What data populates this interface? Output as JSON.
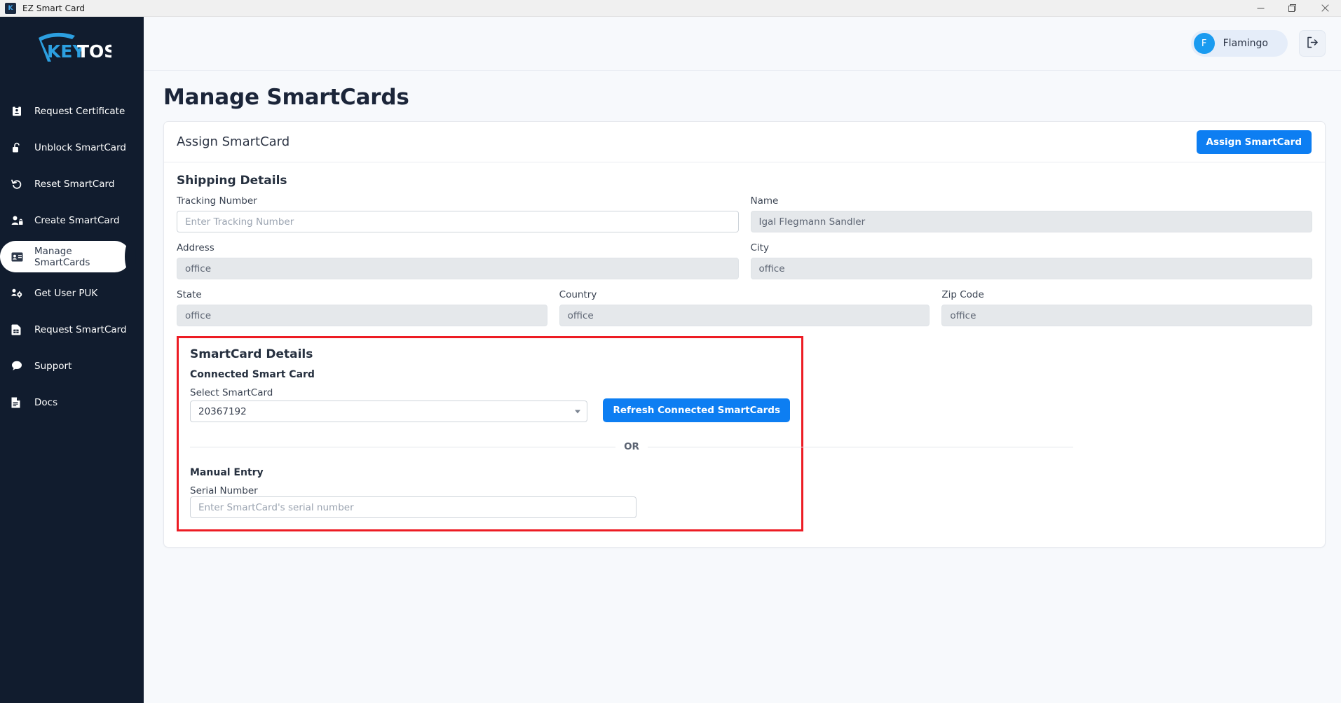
{
  "window": {
    "app_title": "EZ Smart Card",
    "app_icon": "keytos-shield-icon",
    "controls": {
      "minimize": "minimize-icon",
      "restore": "restore-icon",
      "close": "close-icon"
    }
  },
  "brand": {
    "logo_text_key": "KEY",
    "logo_text_tos": "TOS",
    "accent": "#2c9fe0",
    "sidebar_bg": "#111c2e"
  },
  "sidebar": {
    "items": [
      {
        "label": "Request Certificate",
        "icon": "id-badge-icon",
        "active": false
      },
      {
        "label": "Unblock SmartCard",
        "icon": "unlock-icon",
        "active": false
      },
      {
        "label": "Reset SmartCard",
        "icon": "undo-arrow-icon",
        "active": false
      },
      {
        "label": "Create SmartCard",
        "icon": "user-lock-icon",
        "active": false
      },
      {
        "label": "Manage SmartCards",
        "icon": "id-card-icon",
        "active": true
      },
      {
        "label": "Get User PUK",
        "icon": "users-gear-icon",
        "active": false
      },
      {
        "label": "Request SmartCard",
        "icon": "sim-card-icon",
        "active": false
      },
      {
        "label": "Support",
        "icon": "chat-bubble-icon",
        "active": false
      },
      {
        "label": "Docs",
        "icon": "document-icon",
        "active": false
      }
    ]
  },
  "topbar": {
    "user_initial": "F",
    "user_name": "Flamingo",
    "logout_icon": "logout-icon"
  },
  "page": {
    "title": "Manage SmartCards"
  },
  "card": {
    "title": "Assign SmartCard",
    "assign_button": "Assign SmartCard",
    "accent_blue": "#0d7ef2"
  },
  "shipping": {
    "section_title": "Shipping Details",
    "tracking": {
      "label": "Tracking Number",
      "value": "",
      "placeholder": "Enter Tracking Number",
      "disabled": false
    },
    "name": {
      "label": "Name",
      "value": "Igal Flegmann Sandler",
      "placeholder": "",
      "disabled": true
    },
    "address": {
      "label": "Address",
      "value": "office",
      "placeholder": "",
      "disabled": true
    },
    "city": {
      "label": "City",
      "value": "office",
      "placeholder": "",
      "disabled": true
    },
    "state": {
      "label": "State",
      "value": "office",
      "placeholder": "",
      "disabled": true
    },
    "country": {
      "label": "Country",
      "value": "office",
      "placeholder": "",
      "disabled": true
    },
    "zip": {
      "label": "Zip Code",
      "value": "office",
      "placeholder": "",
      "disabled": true
    }
  },
  "smartcard": {
    "highlight_color": "#ed1c24",
    "section_title": "SmartCard Details",
    "connected_label": "Connected Smart Card",
    "select_label": "Select SmartCard",
    "selected_value": "20367192",
    "options": [
      "20367192"
    ],
    "refresh_button": "Refresh Connected SmartCards",
    "or_text": "OR",
    "manual_label": "Manual Entry",
    "serial_label": "Serial Number",
    "serial_value": "",
    "serial_placeholder": "Enter SmartCard's serial number"
  }
}
